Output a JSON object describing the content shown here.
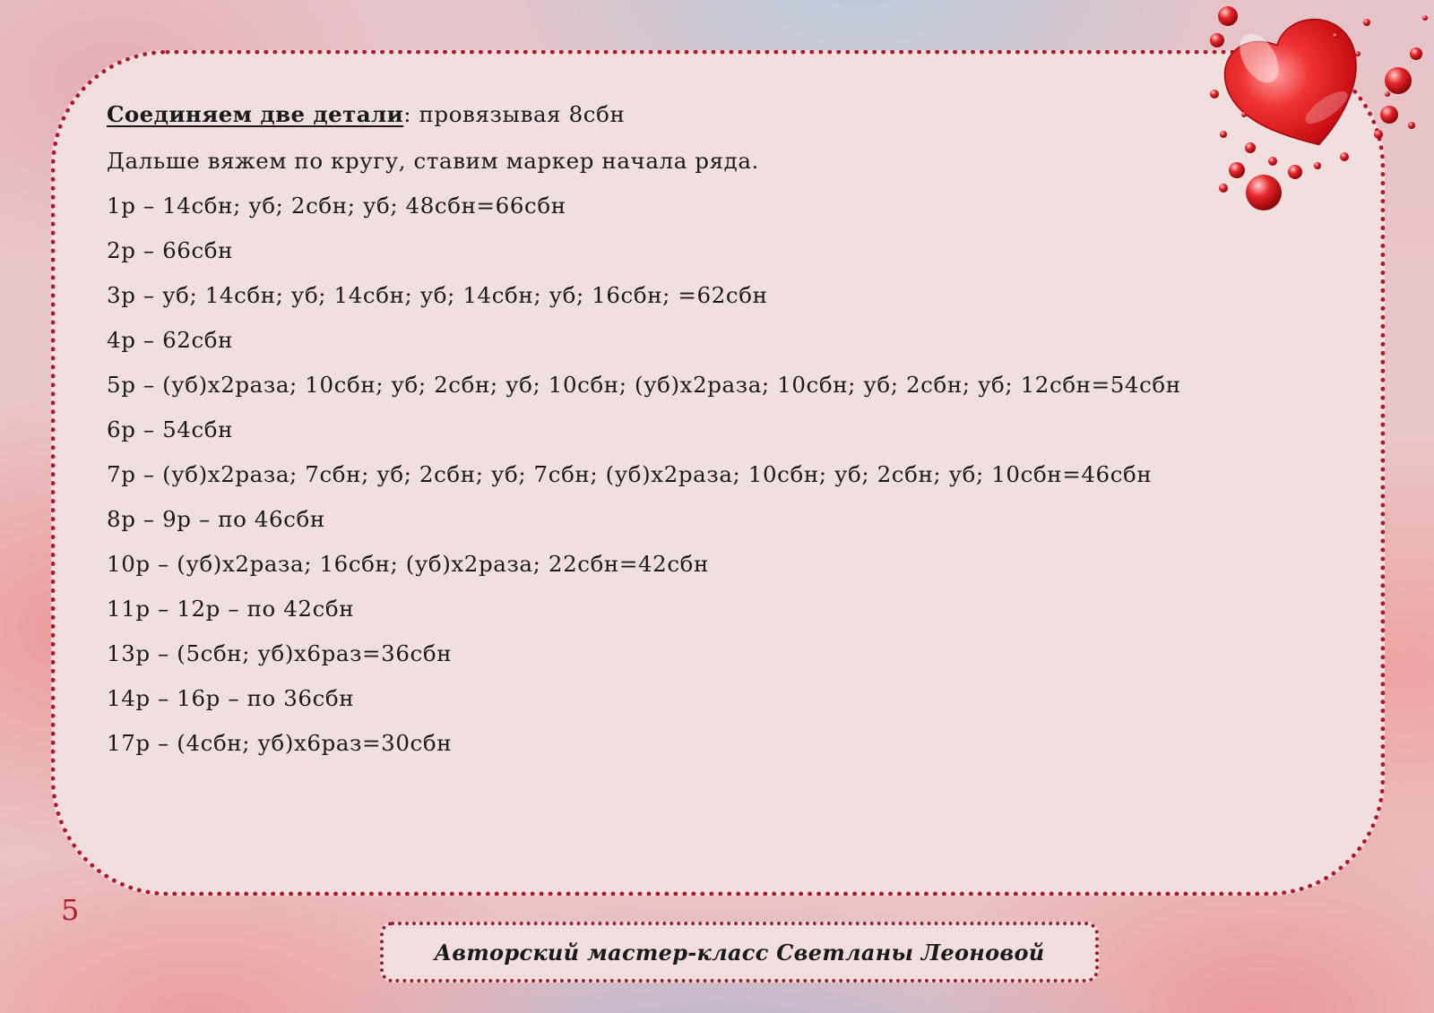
{
  "content": {
    "heading": "Соединяем две детали",
    "heading_rest": ": провязывая 8сбн",
    "intro": "Дальше вяжем по кругу, ставим маркер начала ряда.",
    "rows": [
      "1р – 14сбн; уб; 2сбн; уб; 48сбн=66сбн",
      "2р – 66сбн",
      "3р – уб; 14сбн;  уб; 14сбн; уб; 14сбн; уб;  16сбн; =62сбн",
      "4р – 62сбн",
      "5р – (уб)х2раза; 10сбн; уб; 2сбн; уб; 10сбн;  (уб)х2раза; 10сбн; уб; 2сбн; уб; 12сбн=54сбн",
      "6р – 54сбн",
      "7р – (уб)х2раза; 7сбн; уб; 2сбн; уб; 7сбн; (уб)х2раза; 10сбн; уб; 2сбн; уб; 10сбн=46сбн",
      "8р – 9р – по 46сбн",
      "10р – (уб)х2раза; 16сбн; (уб)х2раза; 22сбн=42сбн",
      "11р – 12р – по 42сбн",
      "13р – (5сбн; уб)х6раз=36сбн",
      "14р – 16р – по 36сбн",
      "17р – (4сбн; уб)х6раз=30сбн"
    ]
  },
  "page_number": "5",
  "footer": {
    "text": "Авторский мастер-класс Светланы Леоновой"
  },
  "decoration": {
    "icon": "heart-with-droplets-icon",
    "heart_color": "#d81a1a",
    "frame_color": "#b1182b"
  }
}
